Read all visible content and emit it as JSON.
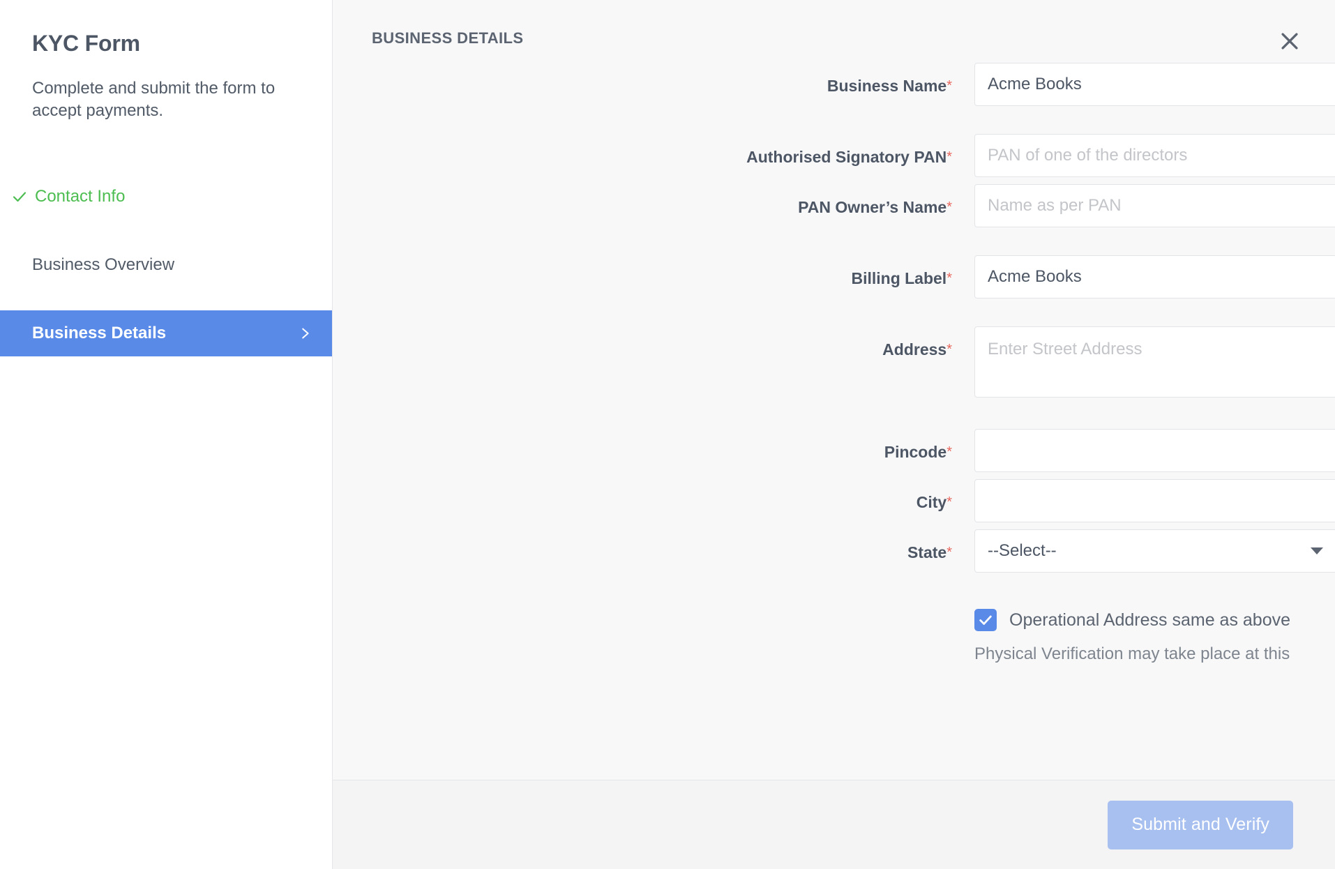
{
  "sidebar": {
    "title": "KYC Form",
    "description": "Complete and submit the form to accept payments.",
    "items": [
      {
        "label": "Contact Info",
        "state": "done",
        "icon": "check-icon"
      },
      {
        "label": "Business Overview",
        "state": "default",
        "icon": ""
      },
      {
        "label": "Business Details",
        "state": "active",
        "icon": "chevron-right-icon"
      }
    ]
  },
  "main": {
    "section_title": "BUSINESS DETAILS",
    "close_icon": "close-icon",
    "fields": [
      {
        "label": "Business Name",
        "required": "*",
        "type": "text",
        "value": "Acme Books",
        "placeholder": ""
      },
      {
        "label": "Authorised Signatory PAN",
        "required": "*",
        "type": "text",
        "value": "",
        "placeholder": "PAN of one of the directors"
      },
      {
        "label": "PAN Owner’s Name",
        "required": "*",
        "type": "text",
        "value": "",
        "placeholder": "Name as per PAN"
      },
      {
        "label": "Billing Label",
        "required": "*",
        "type": "text",
        "value": "Acme Books",
        "placeholder": ""
      },
      {
        "label": "Address",
        "required": "*",
        "type": "textarea",
        "value": "",
        "placeholder": "Enter Street Address"
      },
      {
        "label": "Pincode",
        "required": "*",
        "type": "text",
        "value": "",
        "placeholder": ""
      },
      {
        "label": "City",
        "required": "*",
        "type": "text",
        "value": "",
        "placeholder": ""
      },
      {
        "label": "State",
        "required": "*",
        "type": "select",
        "value": "--Select--",
        "placeholder": ""
      }
    ],
    "checkbox": {
      "label": "Operational Address same as above",
      "checked": true
    },
    "note": "Physical Verification may take place at this"
  },
  "footer": {
    "submit_label": "Submit and Verify"
  },
  "colors": {
    "accent_blue": "#5a8ae8",
    "submit_blue": "#a8c0f0",
    "success_green": "#4cbd50",
    "required_red": "#e8685e",
    "text_dark": "#4d5664",
    "panel_bg": "#f8f8f9"
  }
}
